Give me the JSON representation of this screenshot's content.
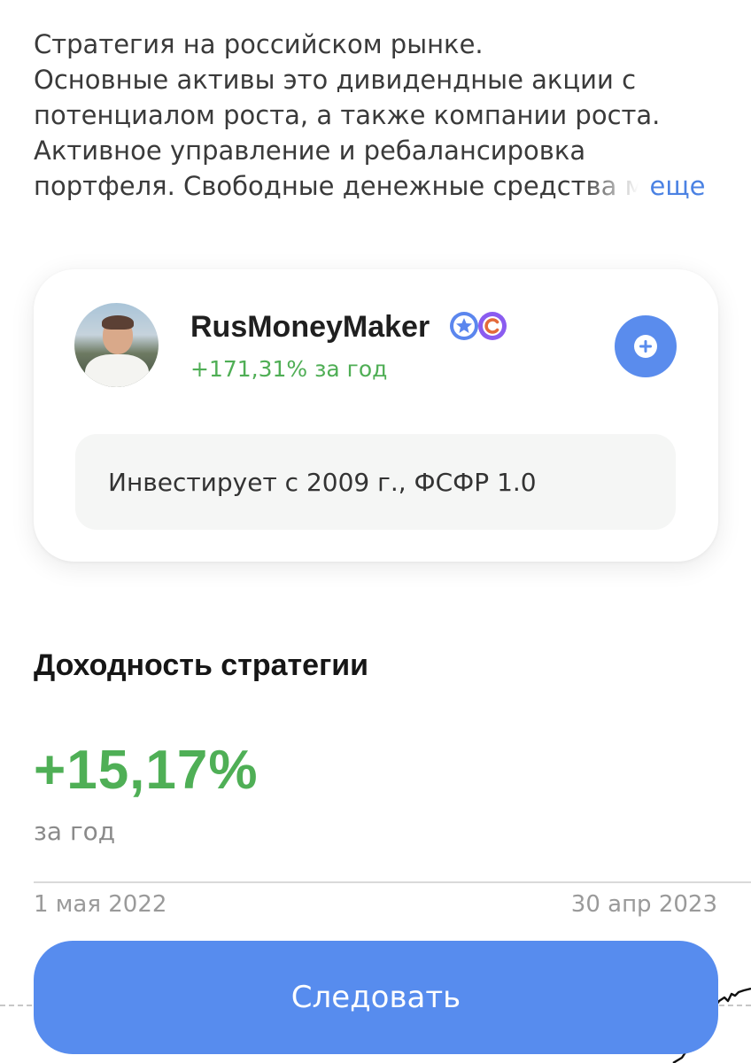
{
  "description": {
    "lines": [
      "Стратегия на российском рынке.",
      "Основные активы это дивидендные акции с",
      "потенциалом роста, а также компании роста.",
      "Активное управление и ребалансировка",
      "портфеля. Свободные денежные средства м"
    ],
    "more_label": "еще"
  },
  "author": {
    "name": "RusMoneyMaker",
    "badges": [
      "star-badge-icon",
      "c-badge-icon"
    ],
    "year_return": "+171,31% за год",
    "info": "Инвестирует с 2009 г., ФСФР 1.0"
  },
  "strategy": {
    "section_title": "Доходность стратегии",
    "return_value": "+15,17%",
    "period_label": "за год"
  },
  "chart": {
    "start_date": "1 мая 2022",
    "end_date": "30 апр 2023"
  },
  "follow_button": {
    "label": "Следовать"
  },
  "colors": {
    "accent_blue": "#578cee",
    "positive_green": "#4faf56",
    "badge_purple": "#8a5cf0",
    "badge_blue": "#5b86ee"
  }
}
